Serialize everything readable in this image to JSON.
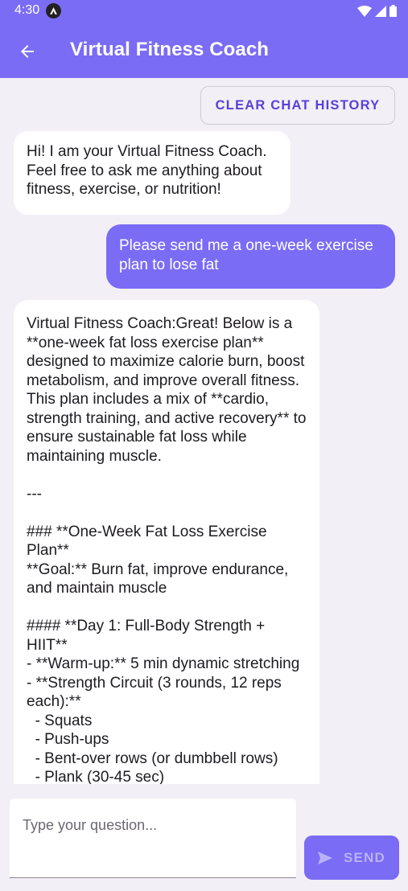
{
  "status_bar": {
    "time": "4:30"
  },
  "app_bar": {
    "title": "Virtual Fitness Coach"
  },
  "chat": {
    "clear_button": "CLEAR CHAT HISTORY",
    "messages": [
      {
        "role": "bot",
        "text": "Hi! I am your Virtual Fitness Coach. Feel free to ask me anything about fitness, exercise, or nutrition!"
      },
      {
        "role": "user",
        "text": "Please send me a one-week exercise plan to lose fat"
      },
      {
        "role": "bot",
        "text": "Virtual Fitness Coach:Great! Below is a **one-week fat loss exercise plan** designed to maximize calorie burn, boost metabolism, and improve overall fitness. This plan includes a mix of **cardio, strength training, and active recovery** to ensure sustainable fat loss while maintaining muscle.\n\n---\n\n### **One-Week Fat Loss Exercise Plan**\n**Goal:** Burn fat, improve endurance, and maintain muscle\n\n#### **Day 1: Full-Body Strength + HIIT**\n- **Warm-up:** 5 min dynamic stretching\n- **Strength Circuit (3 rounds, 12 reps each):**\n  - Squats\n  - Push-ups\n  - Bent-over rows (or dumbbell rows)\n  - Plank (30-45 sec)"
      }
    ]
  },
  "input": {
    "placeholder": "Type your question...",
    "send_label": "SEND"
  },
  "colors": {
    "primary": "#7a6cf5",
    "background": "#f3eff6",
    "bot_bubble": "#ffffff",
    "accent_text": "#5a3fd8"
  }
}
